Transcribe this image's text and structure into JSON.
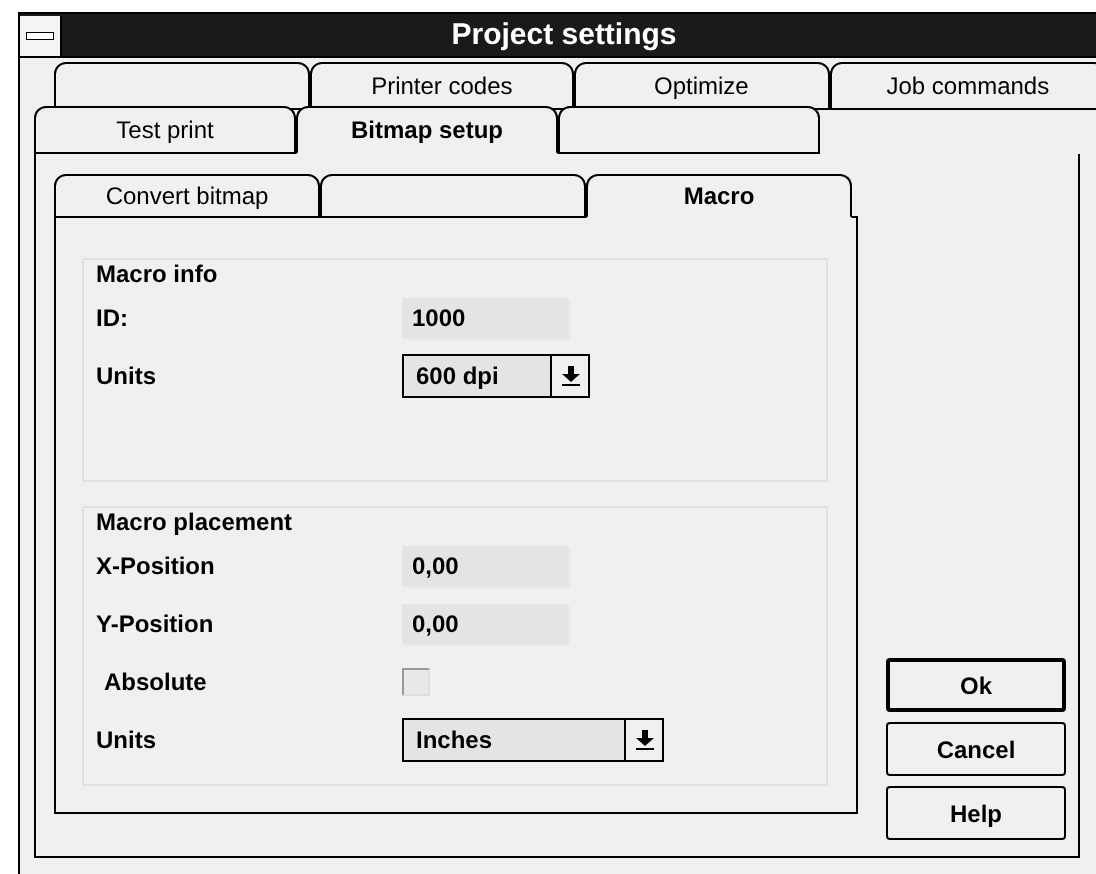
{
  "window": {
    "title": "Project settings"
  },
  "tab_rows": [
    {
      "tabs": [
        {
          "kind": "blank",
          "selected": false
        },
        {
          "kind": "label",
          "label": "Printer codes",
          "selected": false
        },
        {
          "kind": "label",
          "label": "Optimize",
          "selected": false
        },
        {
          "kind": "label",
          "label": "Job commands",
          "selected": false
        }
      ]
    },
    {
      "tabs": [
        {
          "kind": "label",
          "label": "Test print",
          "selected": false
        },
        {
          "kind": "label",
          "label": "Bitmap setup",
          "selected": true
        },
        {
          "kind": "blank",
          "selected": false
        }
      ]
    }
  ],
  "inner_tabs": [
    {
      "kind": "label",
      "label": "Convert bitmap",
      "selected": false
    },
    {
      "kind": "blank",
      "selected": false
    },
    {
      "kind": "label",
      "label": "Macro",
      "selected": true
    }
  ],
  "groups": [
    {
      "title": "Macro info",
      "rows": [
        {
          "kind": "field",
          "label": "ID:",
          "value": "1000"
        },
        {
          "kind": "dropdown",
          "label": "Units",
          "value": "600 dpi"
        }
      ]
    },
    {
      "title": "Macro placement",
      "rows": [
        {
          "kind": "field",
          "label": "X-Position",
          "value": "0,00"
        },
        {
          "kind": "field",
          "label": "Y-Position",
          "value": "0,00"
        },
        {
          "kind": "checkbox",
          "label": "Absolute",
          "checked": false
        },
        {
          "kind": "dropdown",
          "label": "Units",
          "value": "Inches"
        }
      ]
    }
  ],
  "buttons": [
    {
      "label": "Ok",
      "default": true
    },
    {
      "label": "Cancel",
      "default": false
    },
    {
      "label": "Help",
      "default": false
    }
  ]
}
